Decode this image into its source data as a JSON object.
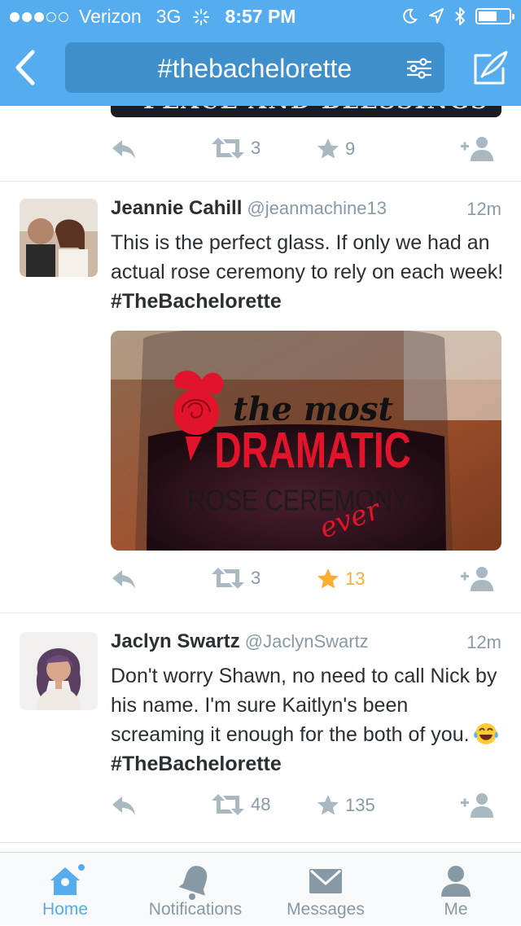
{
  "status_bar": {
    "carrier": "Verizon",
    "network": "3G",
    "time": "8:57 PM",
    "signal_bars_filled": 3,
    "signal_bars_total": 5,
    "battery_level": 0.5
  },
  "nav": {
    "search_query": "#thebachelorette",
    "back_icon": "chevron-left-icon",
    "filter_icon": "filter-sliders-icon",
    "compose_icon": "compose-quill-icon"
  },
  "colors": {
    "brand": "#55acee",
    "search_box": "#3e8fcb",
    "muted": "#8899a6",
    "favorited": "#ffac33",
    "text": "#292f33"
  },
  "previous_tweet": {
    "image_caption_fragment": "PEACE AND BLESSINGS",
    "retweets": "3",
    "favorites": "9"
  },
  "tweets": [
    {
      "name": "Jeannie Cahill",
      "handle": "@jeanmachine13",
      "time": "12m",
      "text": "This is the perfect glass. If only we had an actual rose ceremony to rely on each week! ",
      "hashtag": "#TheBachelorette",
      "image_text": {
        "line1": "the most",
        "line2": "DRAMATIC",
        "line3": "ROSE CEREMONY",
        "line4": "ever"
      },
      "retweets": "3",
      "favorites": "13",
      "favorited": true
    },
    {
      "name": "Jaclyn Swartz",
      "handle": "@JaclynSwartz",
      "time": "12m",
      "text": "Don't worry Shawn, no need to call Nick by his name. I'm sure Kaitlyn's been screaming it enough for the both of you.",
      "emoji": "tears-of-joy-emoji",
      "hashtag": "#TheBachelorette",
      "retweets": "48",
      "favorites": "135",
      "favorited": false
    }
  ],
  "tabs": [
    {
      "label": "Home",
      "icon": "home-icon",
      "active": true
    },
    {
      "label": "Notifications",
      "icon": "bell-icon",
      "active": false
    },
    {
      "label": "Messages",
      "icon": "envelope-icon",
      "active": false
    },
    {
      "label": "Me",
      "icon": "person-icon",
      "active": false
    }
  ]
}
